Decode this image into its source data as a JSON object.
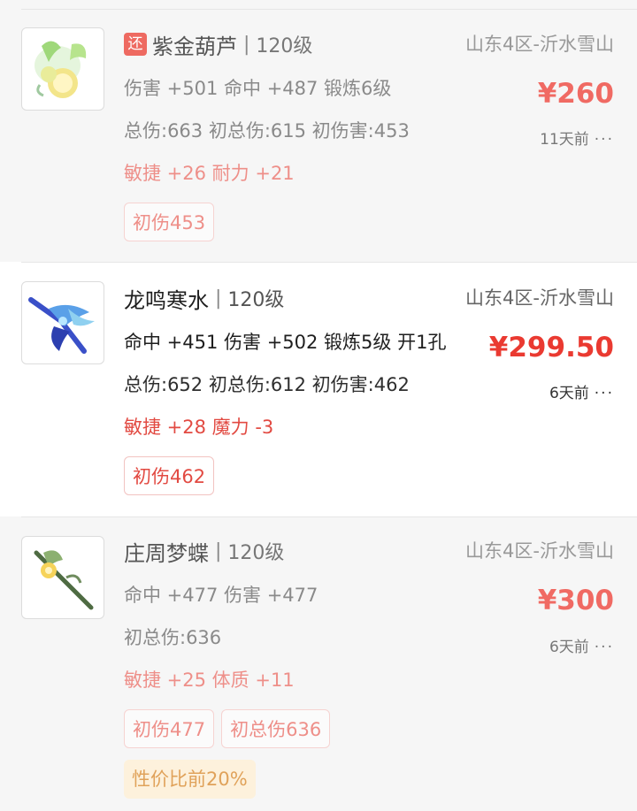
{
  "items": [
    {
      "tag_badge": "还",
      "name": "紫金葫芦",
      "level": "120级",
      "server": "山东4区-沂水雪山",
      "stats": "伤害 +501 命中 +487 锻炼6级",
      "totals": "总伤:663 初总伤:615 初伤害:453",
      "bonus": "敏捷 +26 耐力 +21",
      "price": "¥260",
      "time": "11天前",
      "tags": [
        "初伤453"
      ],
      "icon": "gourd-icon"
    },
    {
      "name": "龙鸣寒水",
      "level": "120级",
      "server": "山东4区-沂水雪山",
      "stats": "命中 +451 伤害 +502 锻炼5级 开1孔",
      "totals": "总伤:652 初总伤:612 初伤害:462",
      "bonus": "敏捷 +28 魔力 -3",
      "price": "¥299.50",
      "time": "6天前",
      "tags": [
        "初伤462"
      ],
      "icon": "dragon-weapon-icon"
    },
    {
      "name": "庄周梦蝶",
      "level": "120级",
      "server": "山东4区-沂水雪山",
      "stats": "命中 +477 伤害 +477",
      "totals": "初总伤:636",
      "bonus": "敏捷 +25 体质 +11",
      "price": "¥300",
      "time": "6天前",
      "tags": [
        "初伤477",
        "初总伤636"
      ],
      "value_tag": "性价比前20%",
      "icon": "staff-icon"
    }
  ],
  "more_symbol": "···",
  "level_divider": "|"
}
